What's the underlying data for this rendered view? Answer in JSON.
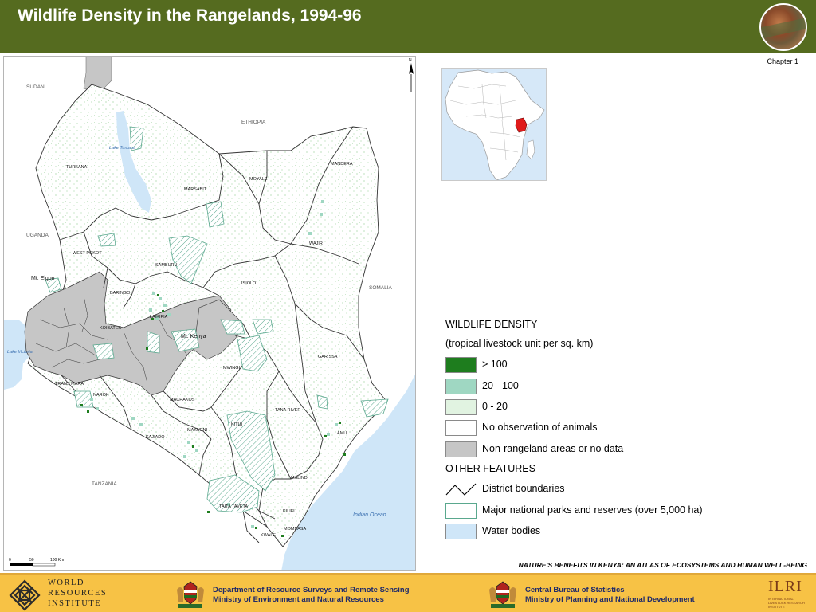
{
  "header": {
    "title": "Wildlife Density in the Rangelands, 1994-96",
    "photo_icon": "rangeland-photo-icon"
  },
  "chapter": "Chapter 1",
  "map": {
    "countries": [
      "SUDAN",
      "ETHIOPIA",
      "UGANDA",
      "SOMALIA",
      "TANZANIA"
    ],
    "districts": [
      "TURKANA",
      "MARSABIT",
      "MOYALE",
      "MANDERA",
      "WAJIR",
      "WEST POKOT",
      "SAMBURU",
      "ISIOLO",
      "BARINGO",
      "LAIKIPIA",
      "KOIBATEK",
      "GARISSA",
      "MWINGI",
      "TRANS MARA",
      "NAROK",
      "MACHAKOS",
      "TANA RIVER",
      "KITUI",
      "MAKUENI",
      "KAJIADO",
      "LAMU",
      "MALINDI",
      "TAITA TAVETA",
      "KILIFI",
      "KWALE",
      "MOMBASA"
    ],
    "mountains": [
      "Mt. Elgon",
      "Mt. Kenya"
    ],
    "lakes": [
      "Lake Turkana",
      "Lake Victoria"
    ],
    "ocean": "Indian Ocean",
    "scale": {
      "labels": [
        "0",
        "50",
        "100 Km"
      ]
    },
    "north_arrow": "N"
  },
  "legend": {
    "heading": "WILDLIFE DENSITY",
    "subheading": "(tropical livestock unit per sq. km)",
    "density_classes": [
      {
        "label": "> 100",
        "color": "#1e7d1e"
      },
      {
        "label": "20 - 100",
        "color": "#9fd7c2"
      },
      {
        "label": "0 - 20",
        "color": "#e1f3e1"
      },
      {
        "label": "No observation of animals",
        "color": "#ffffff"
      },
      {
        "label": "Non-rangeland areas or no data",
        "color": "#c6c6c6"
      }
    ],
    "other_heading": "OTHER FEATURES",
    "other_features": [
      {
        "label": "District boundaries",
        "symbol": "line"
      },
      {
        "label": "Major national parks and reserves (over 5,000 ha)",
        "symbol": "hatch"
      },
      {
        "label": "Water bodies",
        "symbol": "water",
        "color": "#cfe6f8"
      }
    ]
  },
  "atlas_title": "NATURE'S BENEFITS IN KENYA: AN ATLAS OF ECOSYSTEMS AND HUMAN WELL-BEING",
  "footer": {
    "wri": [
      "WORLD",
      "RESOURCES",
      "INSTITUTE"
    ],
    "dept1": [
      "Department of Resource Surveys and Remote Sensing",
      "Ministry of Environment and Natural Resources"
    ],
    "dept2": [
      "Central Bureau of Statistics",
      "Ministry of Planning and National Development"
    ],
    "ilri": {
      "name": "ILRI",
      "sub": [
        "INTERNATIONAL",
        "LIVESTOCK RESEARCH",
        "INSTITUTE"
      ]
    }
  }
}
